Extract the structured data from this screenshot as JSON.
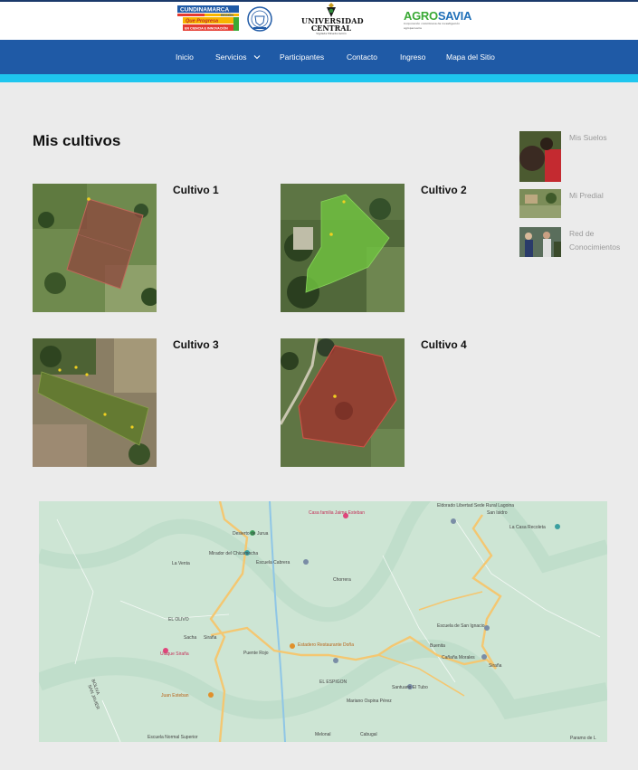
{
  "header": {
    "logos": {
      "cundinamarca": {
        "name": "CUNDINAMARCA",
        "tag1": "Que Progresa",
        "tag2": "EN CIENCIA E INNOVACIÓN",
        "region": "REGIÓN"
      },
      "universidad": {
        "line1": "UNIVERSIDAD",
        "line2": "CENTRAL",
        "line3": "Vigilada Mineducación"
      },
      "agrosavia": {
        "part1": "AGRO",
        "part2": "SAVIA",
        "sub": "Corporación colombiana de investigación agropecuaria"
      }
    }
  },
  "nav": {
    "items": [
      {
        "label": "Inicio"
      },
      {
        "label": "Servicios"
      },
      {
        "label": "Participantes"
      },
      {
        "label": "Contacto"
      },
      {
        "label": "Ingreso"
      },
      {
        "label": "Mapa del Sitio"
      }
    ]
  },
  "main": {
    "title": "Mis cultivos",
    "crops": [
      {
        "title": "Cultivo 1"
      },
      {
        "title": "Cultivo 2"
      },
      {
        "title": "Cultivo 3"
      },
      {
        "title": "Cultivo 4"
      }
    ]
  },
  "sidebar": {
    "items": [
      {
        "label": "Mis Suelos"
      },
      {
        "label": "Mi Predial"
      },
      {
        "label_line1": "Red de",
        "label_line2": "Conocimientos"
      }
    ]
  },
  "map": {
    "labels": [
      "Casa familia Jaime Esteban",
      "Desierto de Jurua",
      "Mirador del Chicamocha",
      "Escuela Cabrera",
      "La Venta",
      "Chorrera",
      "EL OLIVO",
      "Sacha",
      "Siraña",
      "Ulaque Siraña",
      "Juan Esteban",
      "Puente Rojo",
      "Estadero Restaurante Doña",
      "EL ESPIGON",
      "Santuario El Tubo",
      "Mariano Ospina Pérez",
      "Cabugal",
      "Melonal",
      "Escuela Normal Superior",
      "Buenita",
      "Cañaña Morales",
      "Escuela de San Ignacio",
      "Siraña",
      "Eldorado Libertad Sede Rural Lagoina",
      "San Isidro",
      "La Casa Recoleta",
      "Paramo de L",
      "BOLIVA",
      "SAN JAVIER"
    ]
  },
  "colors": {
    "nav_bg": "#1f5aa6",
    "accent_stripe": "#1ec6ef",
    "page_bg": "#ebebeb"
  }
}
